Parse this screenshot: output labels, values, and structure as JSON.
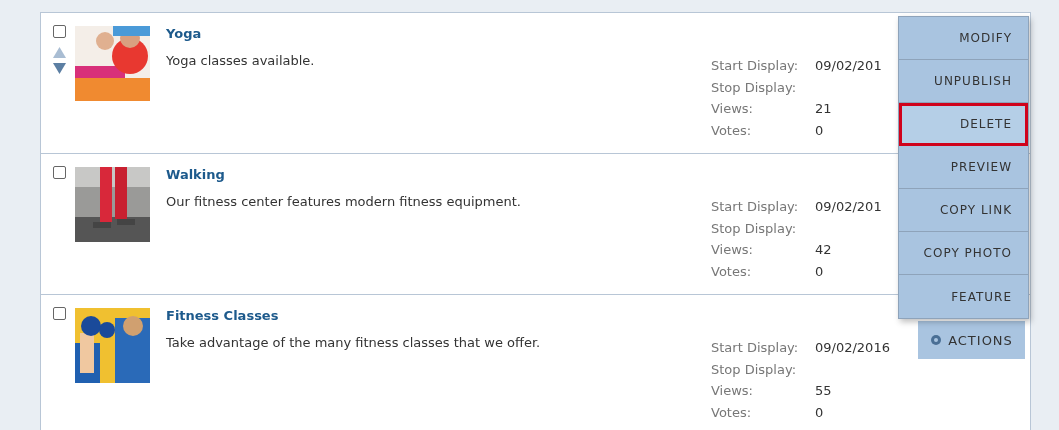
{
  "items": [
    {
      "title": "Yoga",
      "description": "Yoga classes available.",
      "checked": false,
      "reorder": true,
      "stats": [
        {
          "label": "Start Display:",
          "value": "09/02/201"
        },
        {
          "label": "Stop Display:"
        },
        {
          "label": "Views:",
          "value": "21"
        },
        {
          "label": "Votes:",
          "value": "0"
        }
      ]
    },
    {
      "title": "Walking",
      "description": "Our fitness center features modern fitness equipment.",
      "checked": false,
      "reorder": false,
      "stats": [
        {
          "label": "Start Display:",
          "value": "09/02/201"
        },
        {
          "label": "Stop Display:"
        },
        {
          "label": "Views:",
          "value": "42"
        },
        {
          "label": "Votes:",
          "value": "0"
        }
      ]
    },
    {
      "title": "Fitness Classes",
      "description": "Take advantage of the many fitness classes that we offer.",
      "checked": false,
      "reorder": false,
      "actions": "ACTIONS",
      "stats": [
        {
          "label": "Start Display:",
          "value": "09/02/2016"
        },
        {
          "label": "Stop Display:"
        },
        {
          "label": "Views:",
          "value": "55"
        },
        {
          "label": "Votes:",
          "value": "0"
        }
      ]
    }
  ],
  "menu": [
    {
      "label": "MODIFY",
      "selected": false
    },
    {
      "label": "UNPUBLISH",
      "selected": false
    },
    {
      "label": "DELETE",
      "selected": true
    },
    {
      "label": "PREVIEW",
      "selected": false
    },
    {
      "label": "COPY LINK",
      "selected": false
    },
    {
      "label": "COPY PHOTO",
      "selected": false
    },
    {
      "label": "FEATURE",
      "selected": false
    }
  ]
}
